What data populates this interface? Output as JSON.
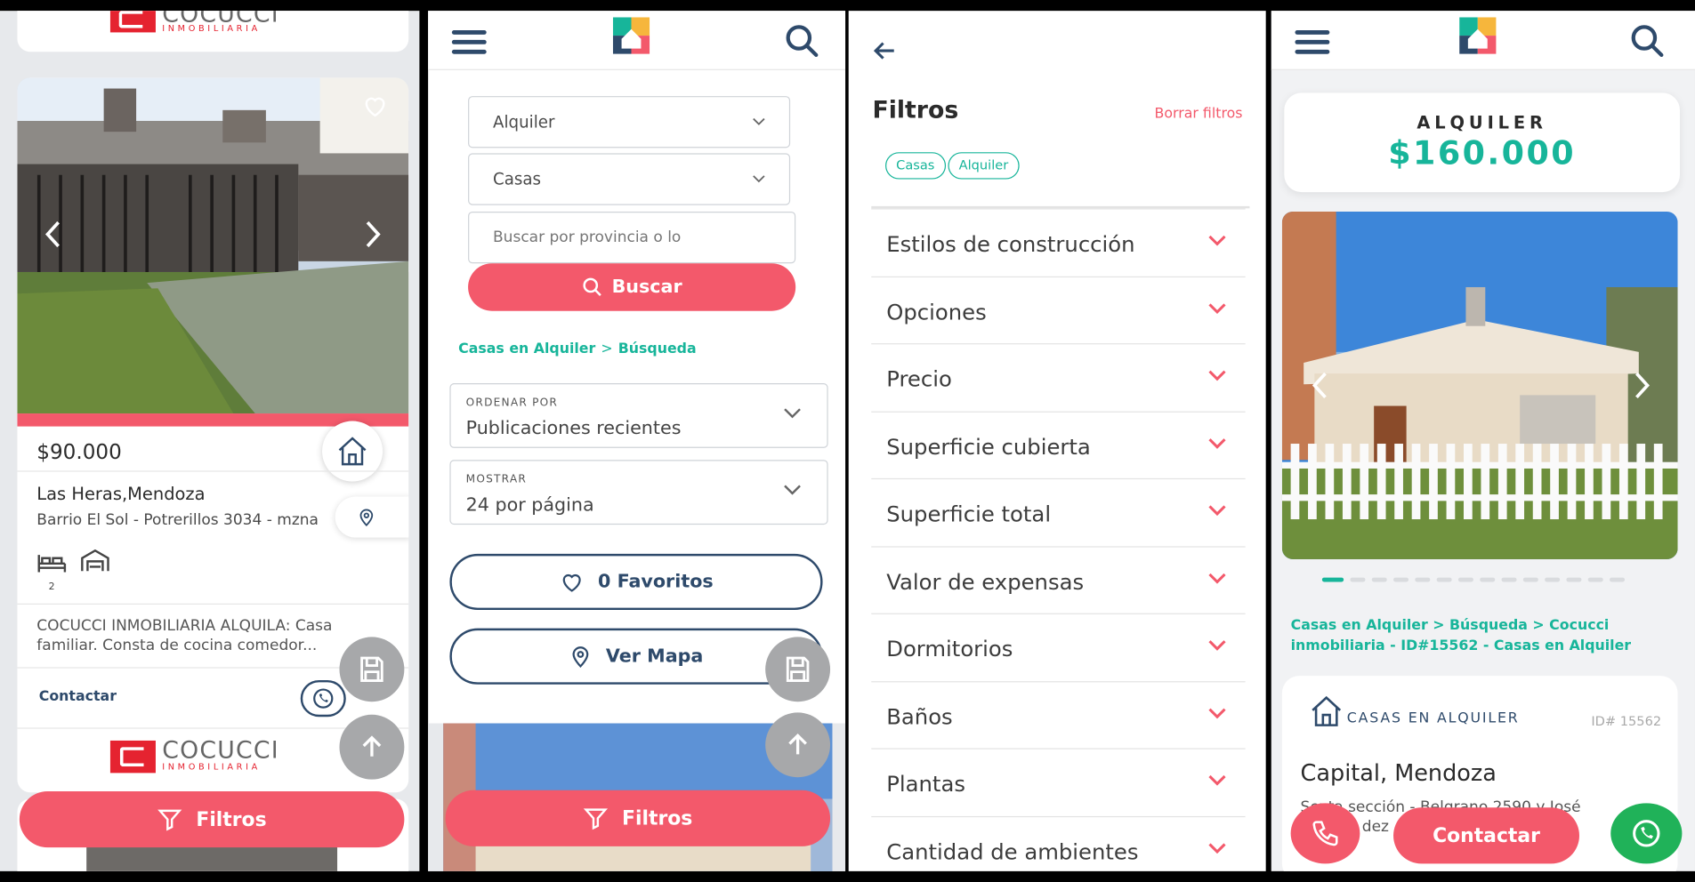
{
  "colors": {
    "accent": "#f3596b",
    "teal": "#17b59a",
    "navy": "#2e4a6b"
  },
  "screen1": {
    "brand_top": "COCUCCI",
    "brand_top_sub": "INMOBILIARIA",
    "price": "$90.000",
    "location": "Las Heras,Mendoza",
    "address": "Barrio El Sol - Potrerillos 3034 - mzna",
    "bedrooms": "2",
    "description_line1": "COCUCCI INMOBILIARIA ALQUILA: Casa",
    "description_line2": "familiar. Consta de cocina comedor...",
    "contact_label": "Contactar",
    "brand_bottom": "COCUCCI",
    "brand_bottom_sub": "INMOBILIARIA",
    "filters_label": "Filtros"
  },
  "screen2": {
    "operation_select": "Alquiler",
    "type_select": "Casas",
    "location_placeholder": "Buscar por provincia o lo",
    "search_button": "Buscar",
    "breadcrumb": [
      "Casas en Alquiler",
      ">",
      "Búsqueda"
    ],
    "order_label": "ORDENAR POR",
    "order_value": "Publicaciones recientes",
    "show_label": "MOSTRAR",
    "show_value": "24 por página",
    "favorites_button": "0 Favoritos",
    "map_button": "Ver Mapa",
    "filters_label": "Filtros"
  },
  "screen3": {
    "title": "Filtros",
    "clear_filters": "Borrar filtros",
    "chips": [
      "Casas",
      "Alquiler"
    ],
    "filters": [
      "Estilos de construcción",
      "Opciones",
      "Precio",
      "Superficie cubierta",
      "Superficie total",
      "Valor de expensas",
      "Dormitorios",
      "Baños",
      "Plantas",
      "Cantidad de ambientes"
    ]
  },
  "screen4": {
    "operation": "ALQUILER",
    "price": "$160.000",
    "breadcrumb_line1": "Casas en Alquiler > Búsqueda > Cocucci",
    "breadcrumb_line2": "inmobiliaria - ID#15562 - Casas en Alquiler",
    "category": "CASAS EN ALQUILER",
    "id_label": "ID# 15562",
    "location": "Capital, Mendoza",
    "address_partial": "Sexta sección - Belgrano 2590 y José",
    "address_partial2": "dez",
    "contact_button": "Contactar"
  }
}
